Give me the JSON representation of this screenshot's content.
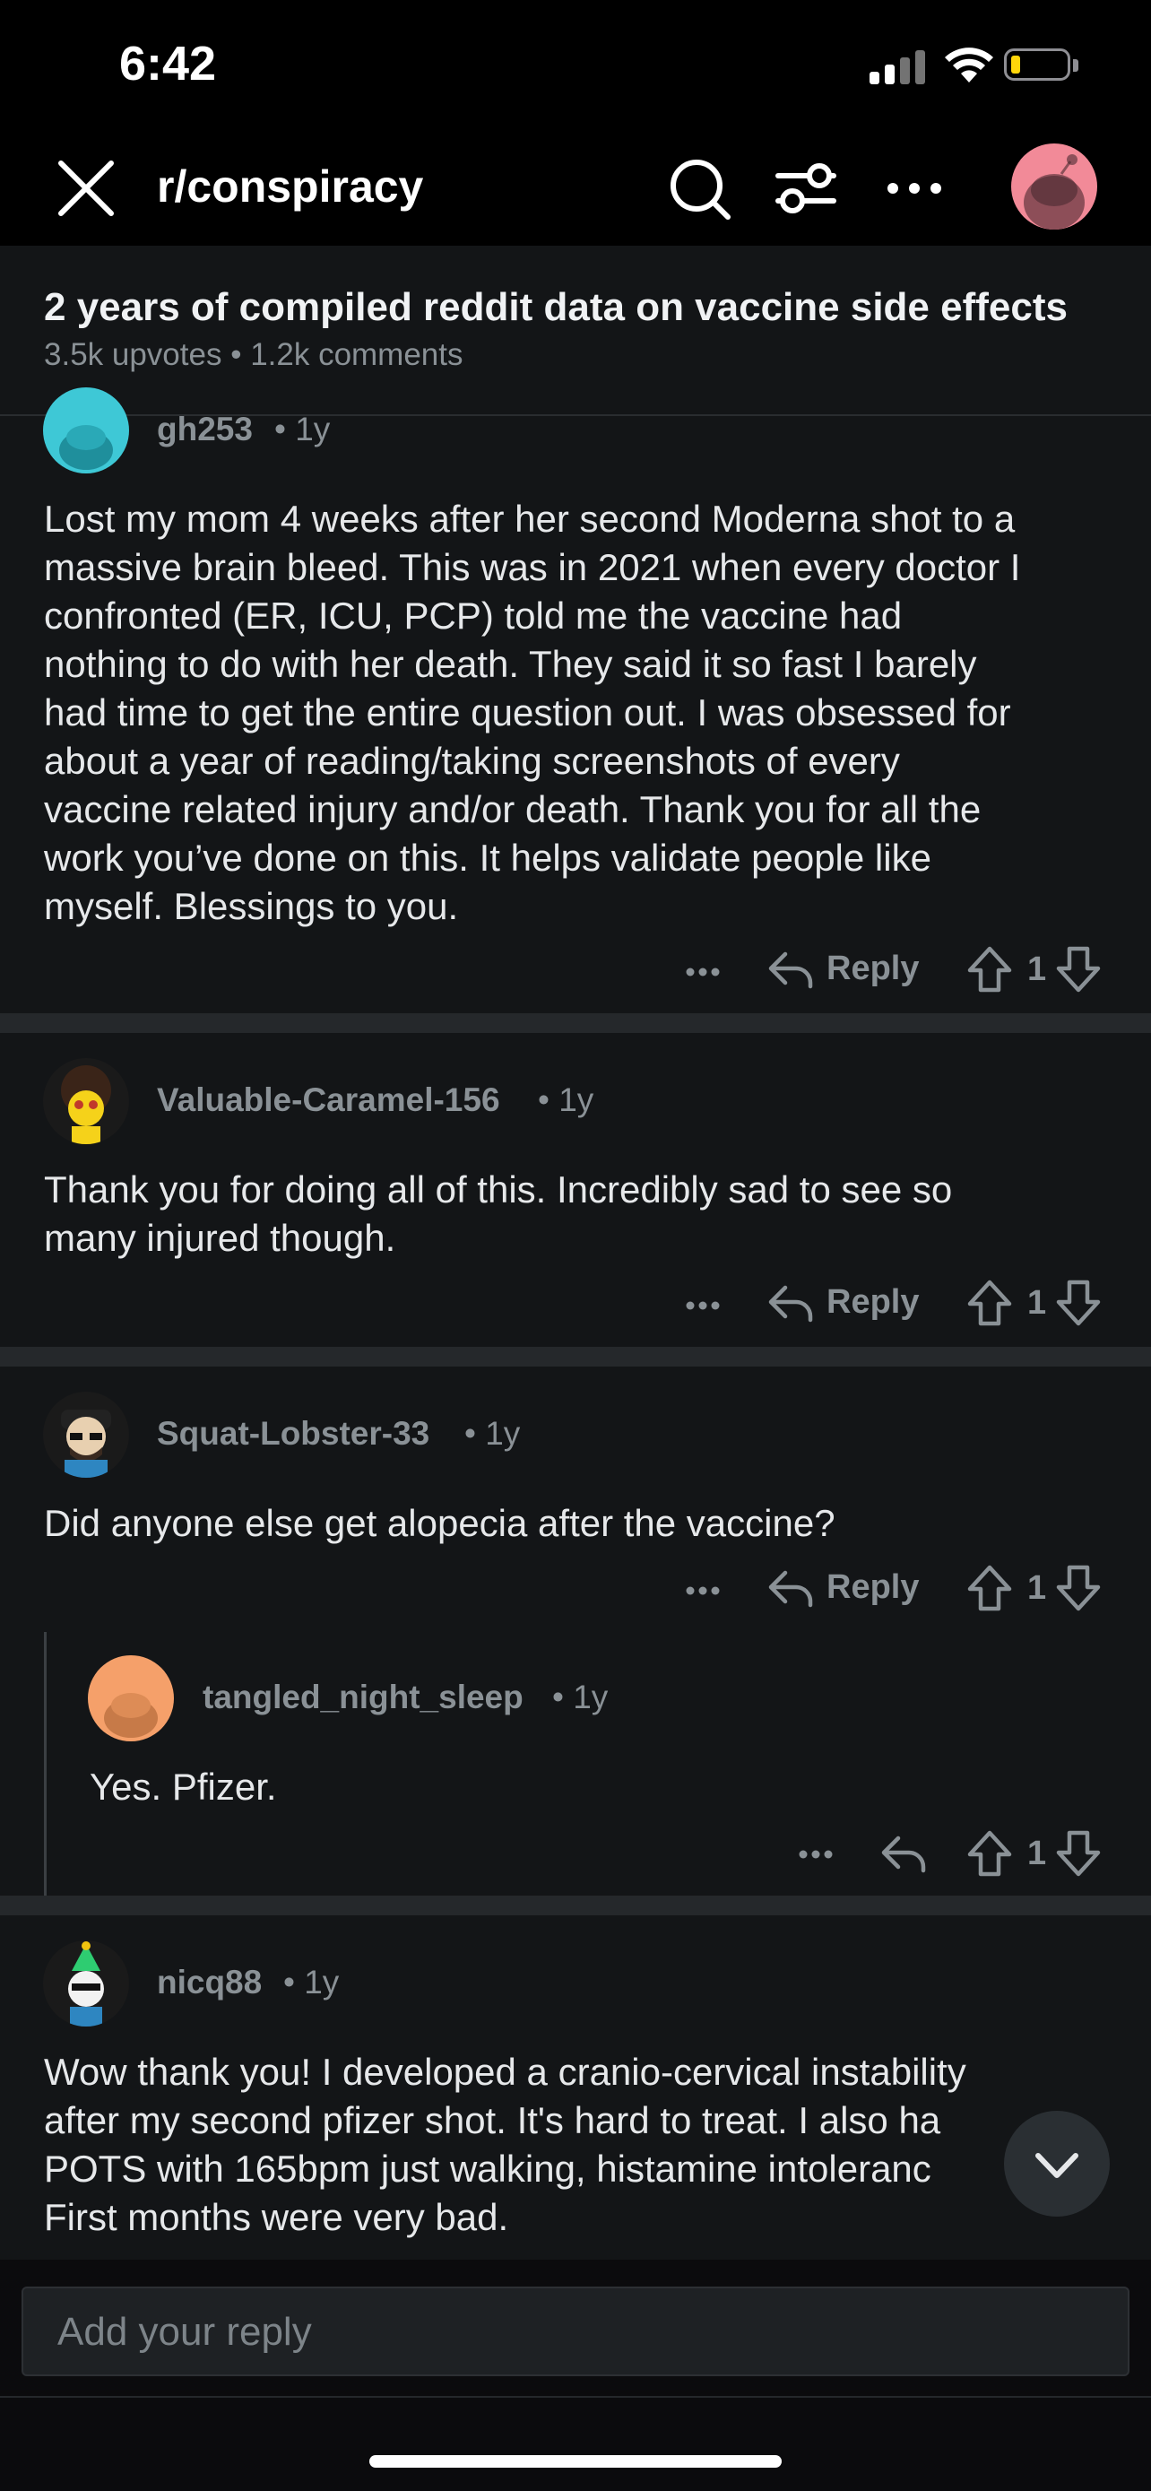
{
  "status_bar": {
    "time": "6:42"
  },
  "header": {
    "subreddit": "r/conspiracy"
  },
  "post": {
    "title": "2 years of compiled reddit data on vaccine side effects",
    "upvotes": "3.5k upvotes",
    "comments": "1.2k comments"
  },
  "comments": [
    {
      "username": "gh253",
      "age": "1y",
      "lines": [
        "Lost my mom 4 weeks after her second Moderna shot to a",
        "massive brain bleed. This was in 2021 when every doctor I",
        "confronted (ER, ICU, PCP) told me the vaccine had",
        "nothing to do with her death. They said it so fast I barely",
        "had time to get the entire question out. I was obsessed for",
        "about a year of reading/taking screenshots of every",
        "vaccine related injury and/or death. Thank you for all the",
        "work you’ve done on this. It helps validate people like",
        "myself. Blessings to you."
      ],
      "reply_label": "Reply",
      "votes": "1",
      "avatar_color": "#3ec8d6"
    },
    {
      "username": "Valuable-Caramel-156",
      "age": "1y",
      "lines": [
        "Thank you for doing all of this. Incredibly sad to see so",
        "many injured though."
      ],
      "reply_label": "Reply",
      "votes": "1"
    },
    {
      "username": "Squat-Lobster-33",
      "age": "1y",
      "lines": [
        "Did anyone else get alopecia after the vaccine?"
      ],
      "reply_label": "Reply",
      "votes": "1",
      "reply": {
        "username": "tangled_night_sleep",
        "age": "1y",
        "text": "Yes. Pfizer.",
        "votes": "1",
        "avatar_color": "#f5a06a"
      }
    },
    {
      "username": "nicq88",
      "age": "1y",
      "lines": [
        "Wow thank you! I developed a cranio-cervical instability",
        "after my second pfizer shot. It's hard to treat. I also ha",
        "POTS with 165bpm just walking, histamine intoleranc",
        "First months were very bad."
      ]
    }
  ],
  "reply_bar": {
    "placeholder": "Add your reply"
  },
  "colors": {
    "background": "#0b0b0d",
    "card": "#131517",
    "muted_text": "#8a9196",
    "header_avatar": "#f28a98"
  }
}
